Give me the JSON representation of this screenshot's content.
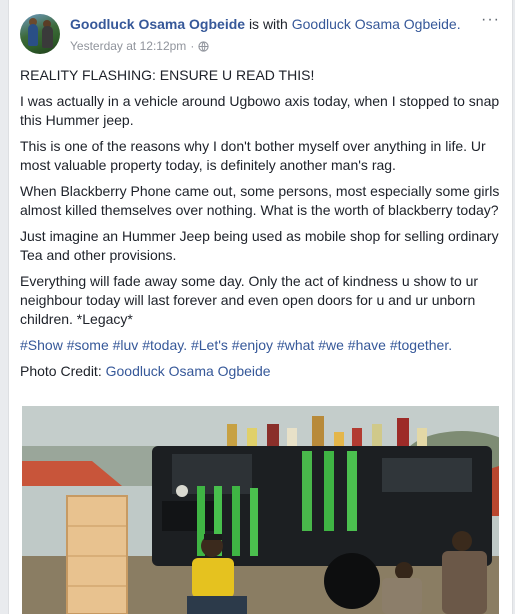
{
  "post": {
    "author": "Goodluck Osama Ogbeide",
    "with_text": "is with",
    "tagged": "Goodluck Osama Ogbeide.",
    "timestamp": "Yesterday at 12:12pm",
    "separator": "·",
    "privacy_icon": "globe-icon",
    "more_label": "···",
    "paragraphs": [
      "REALITY FLASHING: ENSURE U READ THIS!",
      "I was actually in a vehicle around Ugbowo axis today, when I stopped to snap this Hummer jeep.",
      "This is one of the reasons why I don't bother myself over anything in life. Ur most valuable property today, is definitely another man's rag.",
      "When Blackberry Phone came out, some persons, most especially some girls almost killed themselves over nothing. What is the worth of blackberry today?",
      "Just imagine an Hummer Jeep being used as mobile shop for selling ordinary Tea and other provisions.",
      "Everything will fade away some day. Only the act of kindness u show to ur neighbour today will last forever and even open doors for u and ur unborn children. *Legacy*"
    ],
    "hashtags": [
      "#Show",
      "#some",
      "#luv",
      "#today.",
      "#Let's",
      "#enjoy",
      "#what",
      "#we",
      "#have",
      "#together."
    ],
    "credit_label": "Photo Credit:",
    "credit_name": "Goodluck Osama Ogbeide"
  },
  "colors": {
    "link": "#365899",
    "text": "#1d2129",
    "meta": "#90949c",
    "page_bg": "#e9ebee",
    "vehicle": "#1c1f22",
    "sky": "#c4cdcb"
  }
}
